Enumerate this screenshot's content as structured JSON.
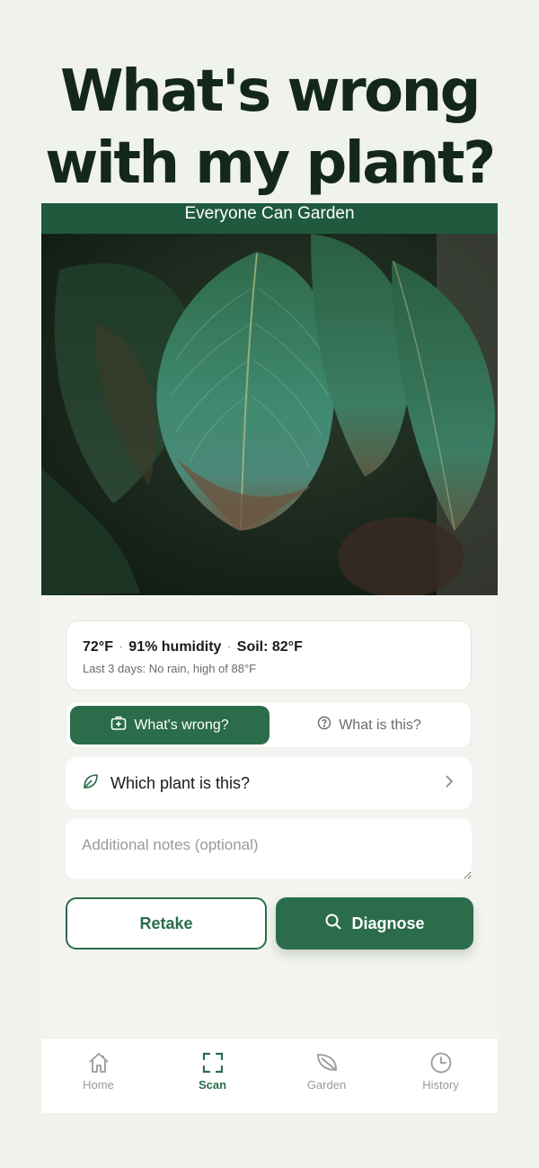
{
  "headline": {
    "line1": "What's wrong",
    "line2": "with my plant?"
  },
  "banner": {
    "title": "Everyone Can Garden"
  },
  "photo": {
    "subject": "plant-leaves-photo"
  },
  "weather": {
    "temp": "72°F",
    "humidity": "91% humidity",
    "soil": "Soil: 82°F",
    "summary": "Last 3 days: No rain, high of 88°F"
  },
  "mode": {
    "options": [
      "What's wrong?",
      "What is this?"
    ],
    "selected": "What's wrong?"
  },
  "plant_select": {
    "label": "Which plant is this?"
  },
  "notes": {
    "placeholder": "Additional notes (optional)",
    "value": ""
  },
  "actions": {
    "retake": "Retake",
    "diagnose": "Diagnose"
  },
  "tabs": [
    {
      "label": "Home",
      "icon": "home-icon"
    },
    {
      "label": "Scan",
      "icon": "scan-icon"
    },
    {
      "label": "Garden",
      "icon": "leaf-icon"
    },
    {
      "label": "History",
      "icon": "clock-icon"
    }
  ],
  "active_tab": "Scan",
  "colors": {
    "brand": "#2b6c4a",
    "banner": "#1f5a3e",
    "background": "#f0f2ec",
    "headline": "#14281a"
  }
}
